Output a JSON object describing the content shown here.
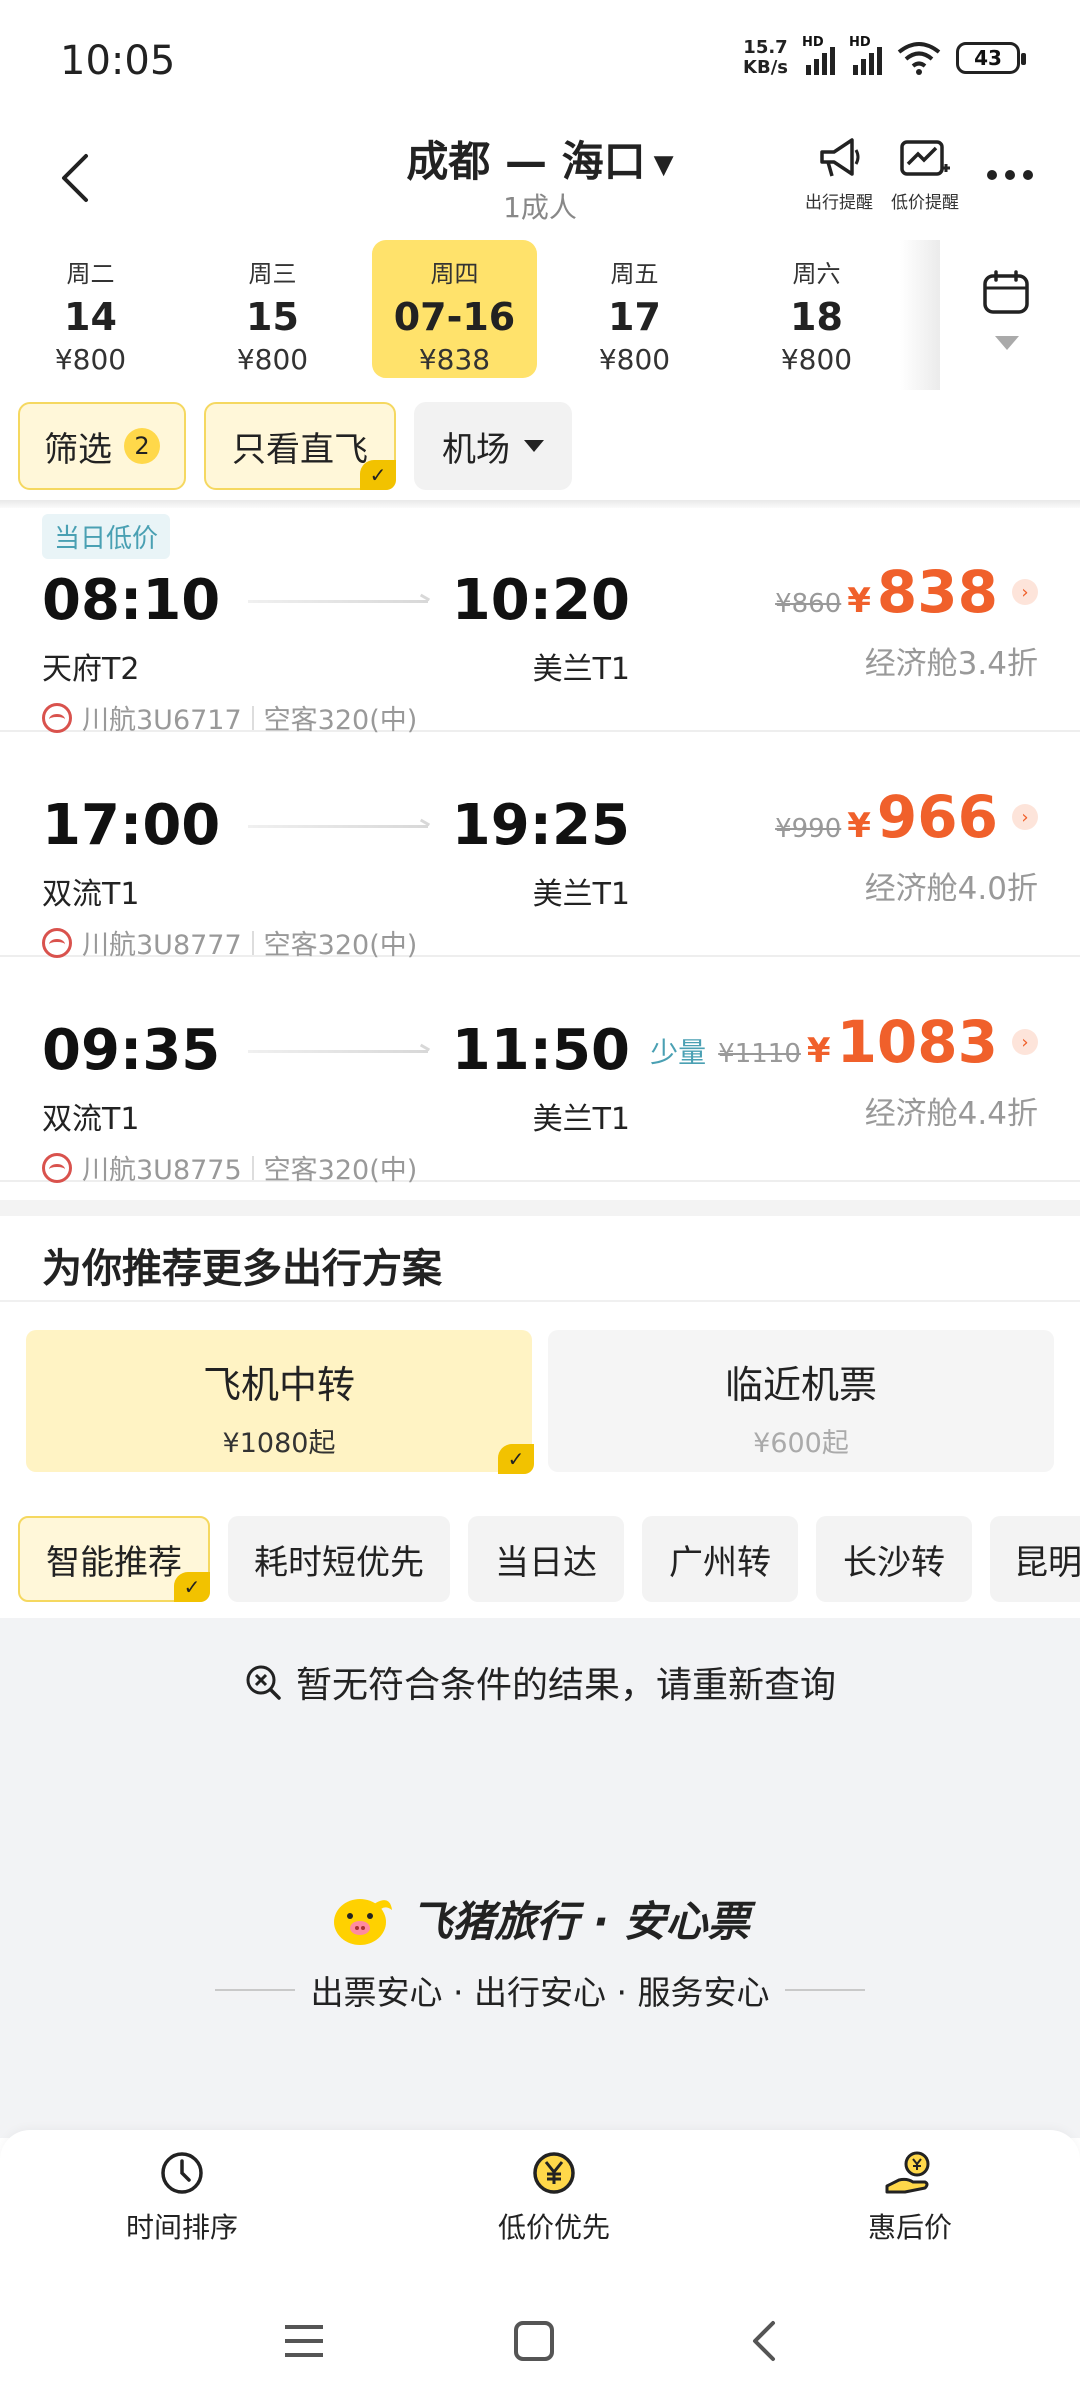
{
  "status_bar": {
    "time": "10:05",
    "net_speed_value": "15.7",
    "net_speed_unit": "KB/s",
    "hd_label": "HD",
    "battery": "43"
  },
  "header": {
    "route": "成都 — 海口",
    "passengers": "1成人",
    "trip_reminder": "出行提醒",
    "low_price_reminder": "低价提醒"
  },
  "dates": [
    {
      "weekday": "周二",
      "date": "14",
      "price": "¥800"
    },
    {
      "weekday": "周三",
      "date": "15",
      "price": "¥800"
    },
    {
      "weekday": "周四",
      "date": "07-16",
      "price": "¥838",
      "active": true
    },
    {
      "weekday": "周五",
      "date": "17",
      "price": "¥800"
    },
    {
      "weekday": "周六",
      "date": "18",
      "price": "¥800"
    }
  ],
  "filters": {
    "filter_label": "筛选",
    "filter_count": "2",
    "direct_only": "只看直飞",
    "airport": "机场"
  },
  "flights": [
    {
      "tag": "当日低价",
      "dep_time": "08:10",
      "dep_airport": "天府T2",
      "arr_time": "10:20",
      "arr_airport": "美兰T1",
      "airline": "川航3U6717",
      "aircraft": "空客320(中)",
      "limited": "",
      "orig_price": "¥860",
      "currency": "¥",
      "price": "838",
      "cabin": "经济舱3.4折"
    },
    {
      "tag": "",
      "dep_time": "17:00",
      "dep_airport": "双流T1",
      "arr_time": "19:25",
      "arr_airport": "美兰T1",
      "airline": "川航3U8777",
      "aircraft": "空客320(中)",
      "limited": "",
      "orig_price": "¥990",
      "currency": "¥",
      "price": "966",
      "cabin": "经济舱4.0折"
    },
    {
      "tag": "",
      "dep_time": "09:35",
      "dep_airport": "双流T1",
      "arr_time": "11:50",
      "arr_airport": "美兰T1",
      "airline": "川航3U8775",
      "aircraft": "空客320(中)",
      "limited": "少量",
      "orig_price": "¥1110",
      "currency": "¥",
      "price": "1083",
      "cabin": "经济舱4.4折"
    }
  ],
  "recommend": {
    "title": "为你推荐更多出行方案",
    "cards": [
      {
        "title": "飞机中转",
        "sub": "¥1080起"
      },
      {
        "title": "临近机票",
        "sub": "¥600起"
      }
    ],
    "chips": [
      "智能推荐",
      "耗时短优先",
      "当日达",
      "广州转",
      "长沙转",
      "昆明"
    ],
    "empty_message": "暂无符合条件的结果，请重新查询"
  },
  "brand": {
    "name": "飞猪旅行 · 安心票",
    "slogan": "出票安心 · 出行安心 · 服务安心"
  },
  "bottom_bar": {
    "time_sort": "时间排序",
    "low_price_first": "低价优先",
    "discount_price": "惠后价"
  },
  "colors": {
    "accent_yellow": "#ffe26b",
    "price_orange": "#f0602b",
    "tag_teal": "#4aa0b3"
  }
}
